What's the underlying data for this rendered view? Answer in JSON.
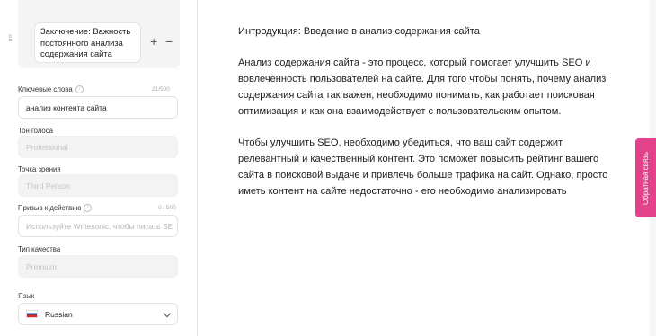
{
  "outline": {
    "item_text": "Заключение: Важность постоянного анализа содержания сайта",
    "add_symbol": "+",
    "remove_symbol": "−"
  },
  "keywords": {
    "label": "Ключевые слова",
    "counter": "21/500",
    "value": "анализ контента сайта"
  },
  "tone": {
    "label": "Тон голоса",
    "value": "Professional"
  },
  "point_of_view": {
    "label": "Точка зрения",
    "value": "Third Person"
  },
  "cta": {
    "label": "Призыв к действию",
    "counter": "0 / 500",
    "placeholder": "Используйте Writesonic, чтобы писать SE"
  },
  "quality": {
    "label": "Тип качества",
    "value": "Premium"
  },
  "language": {
    "label": "Язык",
    "value": "Russian"
  },
  "editor": {
    "heading": "Интродукция: Введение в анализ содержания сайта",
    "paragraph1": "Анализ содержания сайта - это процесс, который помогает улучшить SEO и вовлеченность пользователей на сайте. Для того чтобы понять, почему анализ содержания сайта так важен, необходимо понимать, как работает поисковая оптимизация и как она взаимодействует с пользовательским опытом.",
    "paragraph2": "Чтобы улучшить SEO, необходимо убедиться, что ваш сайт содержит релевантный и качественный контент. Это поможет повысить рейтинг вашего сайта в поисковой выдаче и привлечь больше трафика на сайт. Однако, просто иметь контент на сайте недостаточно - его необходимо анализировать"
  },
  "feedback_tab": {
    "label": "Обратная связь",
    "color": "#e3418a"
  }
}
